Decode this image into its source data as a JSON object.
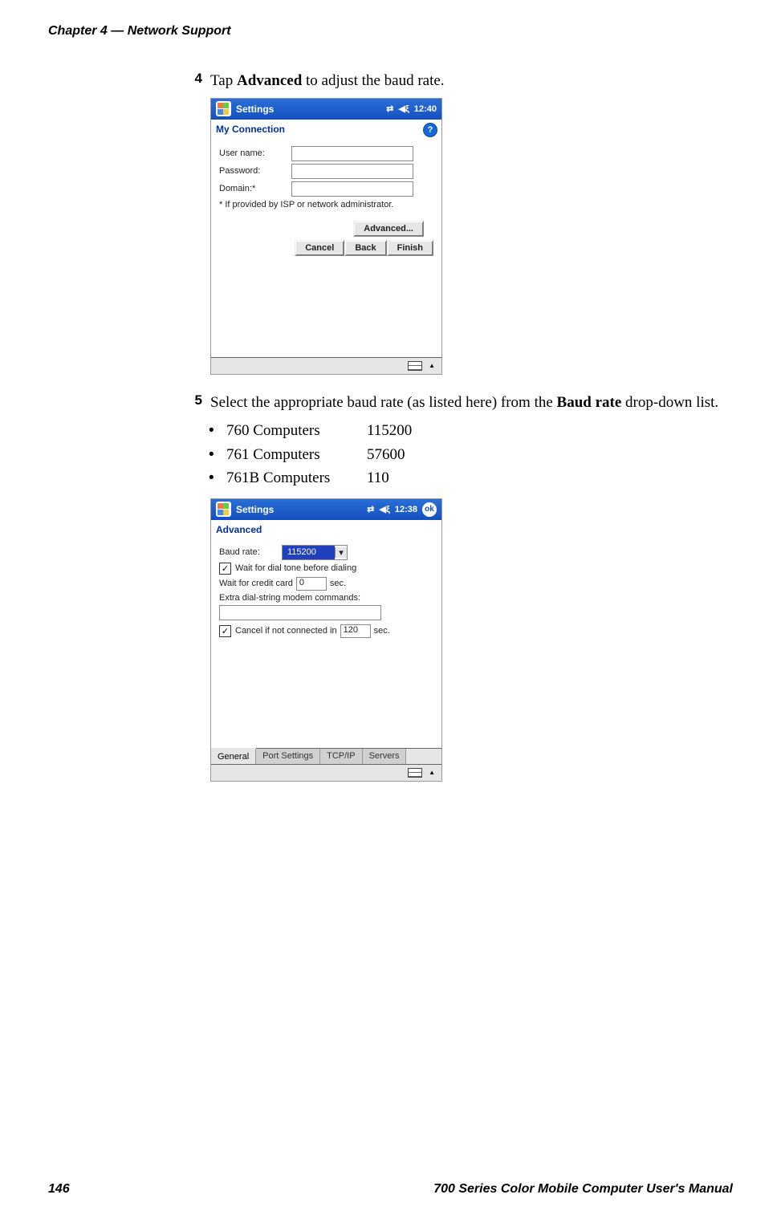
{
  "header": {
    "chapterNum": "Chapter 4",
    "dash": "—",
    "chapterTitle": "  Network Support"
  },
  "step4": {
    "num": "4",
    "pre": "Tap ",
    "bold": "Advanced",
    "post": " to adjust the baud rate."
  },
  "shot1": {
    "title": "Settings",
    "time": "12:40",
    "subtitle": "My Connection",
    "userLabel": "User name:",
    "passLabel": "Password:",
    "domainLabel": "Domain:*",
    "note": "* If provided by ISP or network administrator.",
    "advanced": "Advanced...",
    "cancel": "Cancel",
    "back": "Back",
    "finish": "Finish"
  },
  "step5": {
    "num": "5",
    "pre": "Select the appropriate baud rate (as listed here) from the ",
    "bold": "Baud rate",
    "post": " drop-down list."
  },
  "bullets": [
    {
      "label": "760 Computers",
      "value": "115200"
    },
    {
      "label": "761 Computers",
      "value": "57600"
    },
    {
      "label": "761B Computers",
      "value": "110"
    }
  ],
  "shot2": {
    "title": "Settings",
    "time": "12:38",
    "ok": "ok",
    "subtitle": "Advanced",
    "baudLabel": "Baud rate:",
    "baudValue": "115200",
    "waitDial": "Wait for dial tone before dialing",
    "waitCreditPre": "Wait for credit card",
    "waitCreditVal": "0",
    "waitCreditPost": "sec.",
    "extraLabel": "Extra dial-string modem commands:",
    "cancelNotPre": "Cancel if not connected in",
    "cancelNotVal": "120",
    "cancelNotPost": "sec.",
    "tabs": {
      "general": "General",
      "port": "Port Settings",
      "tcpip": "TCP/IP",
      "servers": "Servers"
    }
  },
  "footer": {
    "pageNum": "146",
    "manual": "700 Series Color Mobile Computer User's Manual"
  },
  "icons": {
    "conn": "⇄",
    "vol": "◀ξ"
  }
}
